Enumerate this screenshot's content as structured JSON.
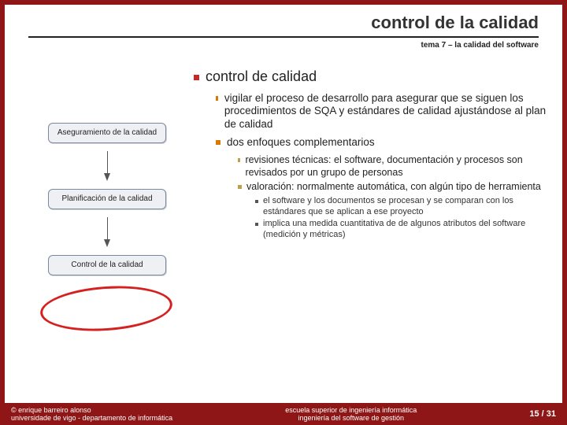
{
  "header": {
    "title": "control de la calidad",
    "subtitle": "tema 7 – la calidad del software"
  },
  "bullets": {
    "main": "control de calidad",
    "sub1_a": "vigilar el proceso de desarrollo para asegurar que se siguen los procedimientos de SQA y estándares de calidad ajustándose al plan de calidad",
    "sub1_b": "dos enfoques complementarios",
    "sub2_a": "revisiones técnicas: el software, documentación y procesos son revisados por un grupo de personas",
    "sub2_b": "valoración: normalmente automática, con algún tipo de herramienta",
    "sub3_a": "el software y los documentos se procesan y se comparan con los estándares que se aplican a ese proyecto",
    "sub3_b": "implica una medida cuantitativa de de algunos atributos del software (medición y métricas)"
  },
  "diagram": {
    "box1": "Aseguramiento de la calidad",
    "box2": "Planificación de la calidad",
    "box3": "Control de la calidad"
  },
  "footer": {
    "left_line1": "© enrique barreiro alonso",
    "left_line2": "universidade de vigo - departamento de informática",
    "center_line1": "escuela superior de ingeniería informática",
    "center_line2": "ingeniería del software de gestión",
    "page": "15 / 31"
  }
}
